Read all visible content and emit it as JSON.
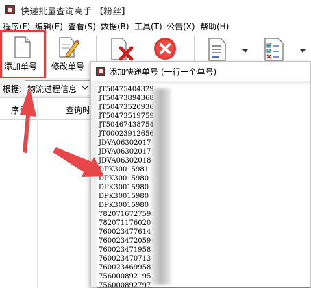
{
  "window": {
    "title": "快递批量查询高手 【粉丝】"
  },
  "menu": [
    "程序(F)",
    "编辑(E)",
    "查看(S)",
    "数据(B)",
    "工具(T)",
    "公告(X)",
    "帮助(H)"
  ],
  "toolbar": {
    "add_label": "添加单号",
    "edit_label": "修改单号"
  },
  "filter": {
    "label": "根据:",
    "value": "物流过程信息"
  },
  "grid": {
    "col_seq": "序号",
    "col_time": "查询时"
  },
  "dialog": {
    "title": "添加快递单号 (一行一个单号)",
    "lines": [
      "JT50475404329",
      "JT50473894368",
      "JT50473520936",
      "JT50473519759",
      "JT50467438754",
      "JT00023912656",
      "JDVA06302017",
      "JDVA06302017",
      "JDVA06302018",
      "DPK30015981",
      "DPK30015980",
      "DPK30015980",
      "DPK30015980",
      "DPK30015980",
      "782071672759",
      "782071176020",
      "760023477614",
      "760023472059",
      "760023471958",
      "760023470713",
      "760023469958",
      "756000892195",
      "756000892797"
    ]
  },
  "colors": {
    "highlight": "#e23c3c",
    "arrow": "#e8474a"
  }
}
